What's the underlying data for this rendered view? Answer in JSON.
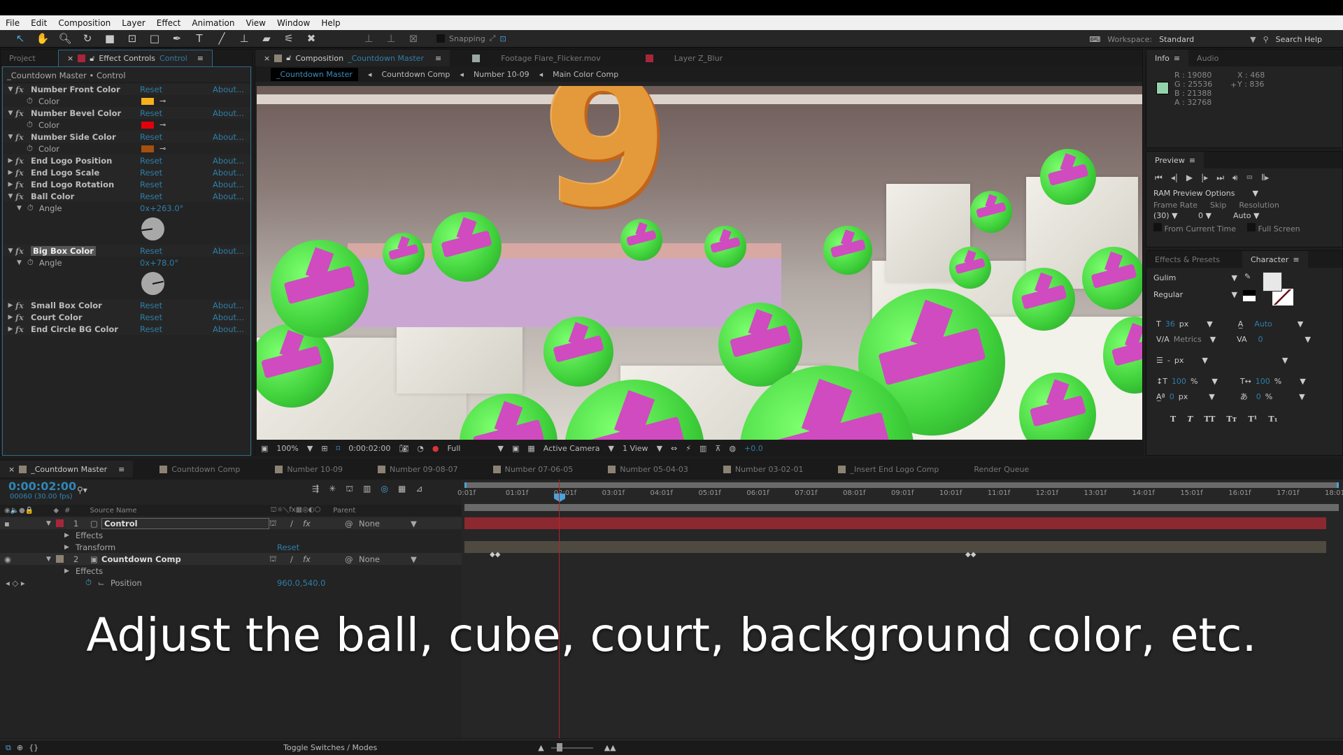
{
  "menu": [
    "File",
    "Edit",
    "Composition",
    "Layer",
    "Effect",
    "Animation",
    "View",
    "Window",
    "Help"
  ],
  "toolbar": {
    "tools": [
      "selection-tool",
      "hand-tool",
      "zoom-tool",
      "rotation-tool",
      "camera-tool",
      "pan-behind-tool",
      "rectangle-tool",
      "pen-tool",
      "type-tool",
      "brush-tool",
      "clone-stamp-tool",
      "eraser-tool",
      "roto-brush-tool",
      "puppet-pin-tool"
    ],
    "snapping_label": "Snapping",
    "workspace_label": "Workspace:",
    "workspace_value": "Standard",
    "search_help": "Search Help"
  },
  "effect_controls": {
    "tabs": {
      "project": "Project",
      "title": "Effect Controls",
      "layer": "Control"
    },
    "path": "_Countdown Master • Control",
    "reset": "Reset",
    "about": "About...",
    "effects": [
      {
        "name": "Number Front Color",
        "expanded": true,
        "prop": "Color",
        "color": "#f5b21c"
      },
      {
        "name": "Number Bevel Color",
        "expanded": true,
        "prop": "Color",
        "color": "#e3000c"
      },
      {
        "name": "Number Side Color",
        "expanded": true,
        "prop": "Color",
        "color": "#a4510f"
      },
      {
        "name": "End Logo Position",
        "expanded": false
      },
      {
        "name": "End Logo Scale",
        "expanded": false
      },
      {
        "name": "End Logo Rotation",
        "expanded": false
      },
      {
        "name": "Ball Color",
        "expanded": true,
        "prop": "Angle",
        "value": "0x+263.0°"
      },
      {
        "name": "Big Box Color",
        "expanded": true,
        "prop": "Angle",
        "value": "0x+78.0°"
      },
      {
        "name": "Small Box Color",
        "expanded": false
      },
      {
        "name": "Court Color",
        "expanded": false
      },
      {
        "name": "End Circle BG Color",
        "expanded": false
      }
    ]
  },
  "composition": {
    "tabs": [
      {
        "label": "Composition",
        "name": "_Countdown Master",
        "color": "#8c8273"
      },
      {
        "label": "Footage",
        "name": "Flare_Flicker.mov",
        "color": "#9aa8a4"
      },
      {
        "label": "Layer",
        "name": "Z_Blur",
        "color": "#a8263a"
      }
    ],
    "breadcrumbs": [
      "_Countdown Master",
      "Countdown Comp",
      "Number 10-09",
      "Main Color Comp"
    ],
    "viewer_digit": "9",
    "footer": {
      "zoom": "100%",
      "timecode": "0:00:02:00",
      "resolution": "Full",
      "camera": "Active Camera",
      "views": "1 View",
      "exposure": "+0.0"
    }
  },
  "info": {
    "tabs": [
      "Info",
      "Audio"
    ],
    "swatch": "#93d3aa",
    "r": "R : 19080",
    "g": "G : 25536",
    "b": "B : 21388",
    "a": "A : 32768",
    "x": "X : 468",
    "y": "Y : 836"
  },
  "preview": {
    "title": "Preview",
    "ram_options": "RAM Preview Options",
    "frame_rate_label": "Frame Rate",
    "frame_rate": "(30)",
    "skip_label": "Skip",
    "skip": "0",
    "resolution_label": "Resolution",
    "resolution": "Auto",
    "from_current": "From Current Time",
    "full_screen": "Full Screen"
  },
  "character": {
    "tabs": [
      "Effects & Presets",
      "Character"
    ],
    "font": "Gulim",
    "style": "Regular",
    "size": "36",
    "size_unit": "px",
    "leading": "Auto",
    "kerning": "Metrics",
    "tracking": "0",
    "stroke": "-",
    "stroke_unit": "px",
    "vscale": "100",
    "hscale": "100",
    "pct": "%",
    "baseline": "0",
    "baseline_unit": "px",
    "tsume": "0",
    "styles": [
      "T",
      "T",
      "TT",
      "Tт",
      "T¹",
      "T₁"
    ]
  },
  "timeline": {
    "tabs": [
      "_Countdown Master",
      "Countdown Comp",
      "Number 10-09",
      "Number 09-08-07",
      "Number 07-06-05",
      "Number 05-04-03",
      "Number 03-02-01",
      "_Insert End Logo Comp",
      "Render Queue"
    ],
    "timecode": "0:00:02:00",
    "frames": "00060 (30.00 fps)",
    "columns": {
      "num": "#",
      "source": "Source Name",
      "parent": "Parent"
    },
    "ruler": [
      "0:01f",
      "01:01f",
      "02:01f",
      "03:01f",
      "04:01f",
      "05:01f",
      "06:01f",
      "07:01f",
      "08:01f",
      "09:01f",
      "10:01f",
      "11:01f",
      "12:01f",
      "13:01f",
      "14:01f",
      "15:01f",
      "16:01f",
      "17:01f",
      "18:01"
    ],
    "layers": [
      {
        "num": "1",
        "name": "Control",
        "parent": "None",
        "label_color": "#a8263a"
      },
      {
        "num": "2",
        "name": "Countdown Comp",
        "parent": "None",
        "label_color": "#8c8273"
      }
    ],
    "sub": {
      "effects": "Effects",
      "transform": "Transform",
      "reset": "Reset",
      "position": "Position",
      "position_value": "960.0,540.0"
    },
    "toggle": "Toggle Switches / Modes"
  },
  "caption": "Adjust the ball, cube, court, background color, etc."
}
